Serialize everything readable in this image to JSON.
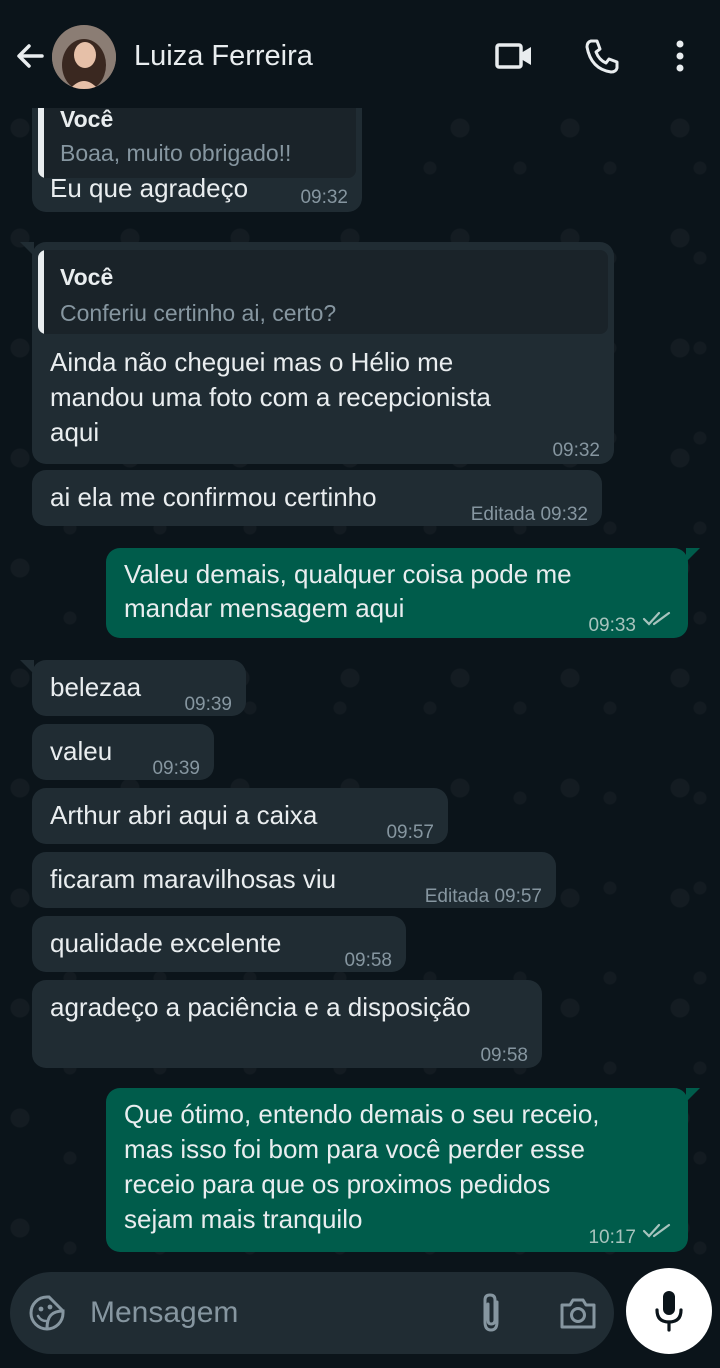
{
  "header": {
    "contact_name": "Luiza Ferreira"
  },
  "messages": [
    {
      "direction": "in",
      "quote_author": "Você",
      "quote_text": "Boaa, muito obrigado!!",
      "lines": [
        "Eu que agradeço"
      ],
      "time": "09:32"
    },
    {
      "direction": "in",
      "quote_author": "Você",
      "quote_text": "Conferiu certinho ai, certo?",
      "lines": [
        "Ainda não cheguei mas o Hélio me",
        "mandou uma foto com a recepcionista",
        "aqui"
      ],
      "time": "09:32"
    },
    {
      "direction": "in",
      "lines": [
        "ai ela me confirmou certinho"
      ],
      "time": "Editada 09:32"
    },
    {
      "direction": "out",
      "lines": [
        "Valeu demais, qualquer coisa pode me",
        "mandar mensagem aqui"
      ],
      "time": "09:33",
      "status": "read"
    },
    {
      "direction": "in",
      "lines": [
        "belezaa"
      ],
      "time": "09:39"
    },
    {
      "direction": "in",
      "lines": [
        "valeu"
      ],
      "time": "09:39"
    },
    {
      "direction": "in",
      "lines": [
        "Arthur abri aqui a caixa"
      ],
      "time": "09:57"
    },
    {
      "direction": "in",
      "lines": [
        "ficaram maravilhosas viu"
      ],
      "time": "Editada 09:57"
    },
    {
      "direction": "in",
      "lines": [
        "qualidade excelente"
      ],
      "time": "09:58"
    },
    {
      "direction": "in",
      "lines": [
        "agradeço a paciência e a disposição"
      ],
      "time": "09:58"
    },
    {
      "direction": "out",
      "lines": [
        "Que ótimo, entendo demais o seu receio,",
        "mas isso foi bom para você perder esse",
        "receio para que os proximos pedidos",
        "sejam mais tranquilo"
      ],
      "time": "10:17",
      "status": "read"
    }
  ],
  "input": {
    "placeholder": "Mensagem"
  },
  "icons": {
    "back": "arrow-left-icon",
    "video": "video-call-icon",
    "call": "phone-icon",
    "menu": "more-vertical-icon",
    "emoji": "sticker-emoji-icon",
    "attach": "paperclip-icon",
    "camera": "camera-icon",
    "mic": "microphone-icon"
  },
  "colors": {
    "background": "#0b141a",
    "incoming_bubble": "#202c33",
    "outgoing_bubble": "#005c4b",
    "read_ticks": "#a7c3bd"
  }
}
